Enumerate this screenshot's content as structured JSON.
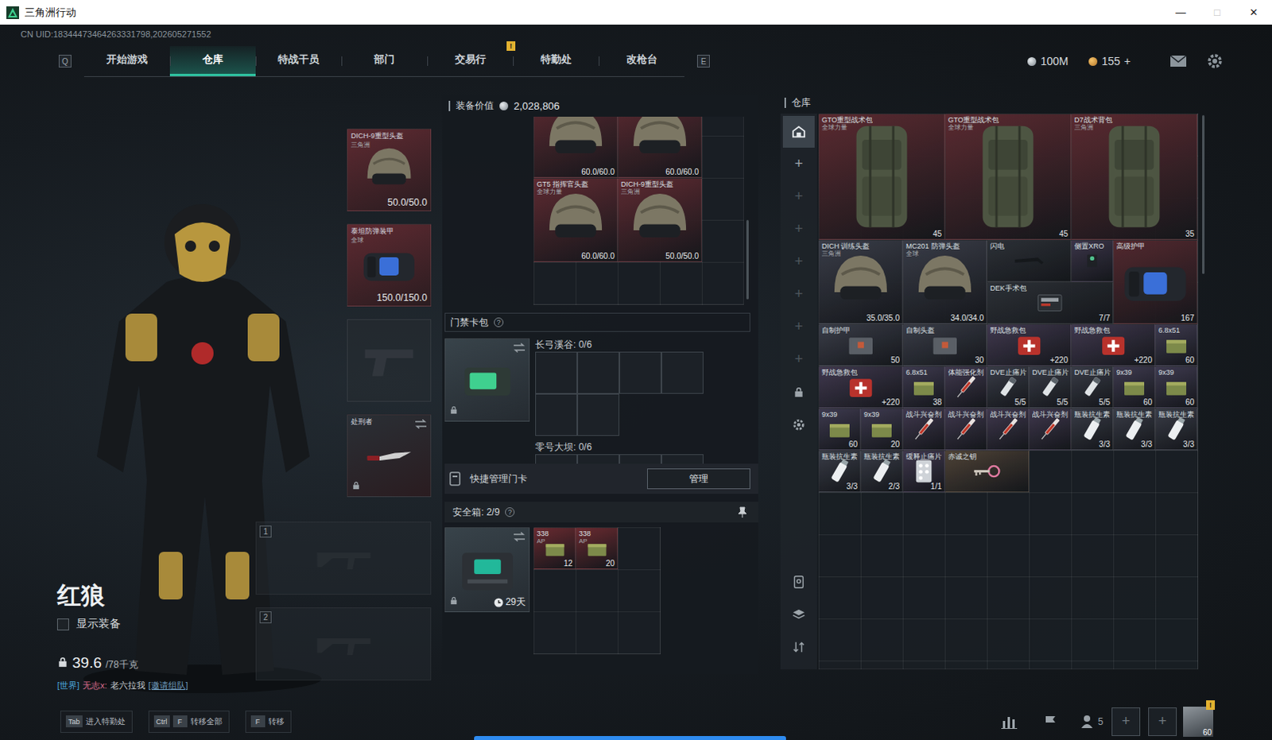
{
  "window": {
    "title": "三角洲行动",
    "controls": [
      "—",
      "□",
      "✕"
    ]
  },
  "uid": "CN UID:18344473464263331798,202605271552",
  "nav": {
    "left_key": "Q",
    "right_key": "E",
    "tabs": [
      {
        "label": "开始游戏",
        "selected": false,
        "badge": ""
      },
      {
        "label": "仓库",
        "selected": true,
        "badge": ""
      },
      {
        "label": "特战干员",
        "selected": false,
        "badge": ""
      },
      {
        "label": "部门",
        "selected": false,
        "badge": ""
      },
      {
        "label": "交易行",
        "selected": false,
        "badge": ""
      },
      {
        "label": "特勤处",
        "selected": false,
        "badge": "!"
      },
      {
        "label": "改枪台",
        "selected": false,
        "badge": ""
      }
    ],
    "currencies": [
      {
        "kind": "silver",
        "value": "100M",
        "action": ""
      },
      {
        "kind": "gold",
        "value": "155",
        "action": "+"
      }
    ]
  },
  "character": {
    "name": "红狼",
    "show_equipment": {
      "label": "显示装备",
      "checked": false
    },
    "weight": {
      "value": "39.6",
      "max": "/78千克"
    },
    "chat": {
      "channel": "[世界]",
      "sender": "无志x:",
      "message": "老六拉我",
      "action": "[邀请组队]"
    }
  },
  "equipment": [
    {
      "kind": "helmet",
      "filled": true,
      "name": "DICH-9重型头盔",
      "sub": "三角洲",
      "durability": "50.0/50.0",
      "locked": false,
      "color": "#5e2a31"
    },
    {
      "kind": "armor",
      "filled": true,
      "name": "泰坦防弹装甲",
      "sub": "全球",
      "durability": "150.0/150.0",
      "locked": false,
      "color": "#5e2a31"
    },
    {
      "kind": "pistol",
      "filled": false,
      "name": "",
      "sub": "",
      "durability": "",
      "locked": false,
      "color": "#262b31"
    },
    {
      "kind": "melee",
      "filled": true,
      "name": "处刑者",
      "sub": "",
      "durability": "",
      "locked": true,
      "color": "#2a2f35"
    }
  ],
  "weapons": [
    {
      "index": "1",
      "filled": false
    },
    {
      "index": "2",
      "filled": false
    }
  ],
  "loadout": {
    "title": "装备价值",
    "value": "2,028,806",
    "items": [
      {
        "kind": "helmet",
        "name": "",
        "sub": "",
        "durability": "60.0/60.0",
        "color": "#5e2a31"
      },
      {
        "kind": "helmet",
        "name": "",
        "sub": "",
        "durability": "60.0/60.0",
        "color": "#5e2a31"
      },
      {
        "kind": "helmet",
        "name": "GT5 指挥官头盔",
        "sub": "全球力量",
        "durability": "60.0/60.0",
        "color": "#5e2a31"
      },
      {
        "kind": "helmet",
        "name": "DICH-9重型头盔",
        "sub": "三角洲",
        "durability": "50.0/50.0",
        "color": "#5e2a31"
      }
    ]
  },
  "keycards": {
    "title": "门禁卡包",
    "help": "?",
    "locked": true,
    "zones": [
      {
        "label": "长弓溪谷: 0/6",
        "slots": 6
      },
      {
        "label": "零号大坝: 0/6",
        "slots": 6
      }
    ],
    "manage_label": "快捷管理门卡",
    "manage_button": "管理"
  },
  "safe": {
    "title": "安全箱: 2/9",
    "help": "?",
    "expiry": "29天",
    "locked": true,
    "slots": 9,
    "items": [
      {
        "line1": "338",
        "line2": "AP",
        "count": "12",
        "color": "#6a2a30"
      },
      {
        "line1": "338",
        "line2": "AP",
        "count": "20",
        "color": "#6a2a30"
      }
    ]
  },
  "warehouse": {
    "title": "仓库",
    "sidebar": [
      {
        "kind": "warehouse",
        "label": "",
        "selected": true,
        "disabled": false
      },
      {
        "kind": "add",
        "label": "+",
        "selected": false,
        "disabled": false
      },
      {
        "kind": "add",
        "label": "+",
        "selected": false,
        "disabled": true
      },
      {
        "kind": "add",
        "label": "+",
        "selected": false,
        "disabled": true
      },
      {
        "kind": "add",
        "label": "+",
        "selected": false,
        "disabled": true
      },
      {
        "kind": "add",
        "label": "+",
        "selected": false,
        "disabled": true
      },
      {
        "kind": "add",
        "label": "+",
        "selected": false,
        "disabled": true
      },
      {
        "kind": "add",
        "label": "+",
        "selected": false,
        "disabled": true
      },
      {
        "kind": "lock",
        "label": "",
        "selected": false,
        "disabled": false
      },
      {
        "kind": "settings",
        "label": "",
        "selected": false,
        "disabled": false
      },
      {
        "kind": "vault",
        "label": "",
        "selected": false,
        "disabled": false
      },
      {
        "kind": "layers",
        "label": "",
        "selected": false,
        "disabled": false
      },
      {
        "kind": "sort",
        "label": "",
        "selected": false,
        "disabled": false
      }
    ],
    "items": [
      {
        "kind": "backpack",
        "name": "GTO重型战术包",
        "sub": "全球力量",
        "count": "45",
        "color": "#5b2a30"
      },
      {
        "kind": "backpack",
        "name": "GTO重型战术包",
        "sub": "全球力量",
        "count": "45",
        "color": "#5b2a30"
      },
      {
        "kind": "backpack",
        "name": "D7战术背包",
        "sub": "三角洲",
        "count": "35",
        "color": "#5b2a30"
      },
      {
        "kind": "helmet",
        "name": "DICH 训练头盔",
        "sub": "三角洲",
        "count": "35.0/35.0",
        "color": "#393c47"
      },
      {
        "kind": "helmet",
        "name": "MC201 防弹头盔",
        "sub": "全球",
        "count": "34.0/34.0",
        "color": "#393c47"
      },
      {
        "kind": "tool-wide",
        "name": "闪电",
        "sub": "",
        "count": "",
        "color": "#2c3036"
      },
      {
        "kind": "tool",
        "name": "侧置XRO",
        "sub": "",
        "count": "",
        "color": "#3a3448"
      },
      {
        "kind": "armor",
        "name": "高级护甲",
        "sub": "",
        "count": "167",
        "color": "#53282e"
      },
      {
        "kind": "surgical",
        "name": "DEK手术包",
        "sub": "",
        "count": "7/7",
        "color": "#2c3036"
      },
      {
        "kind": "case",
        "name": "自制护甲",
        "sub": "",
        "count": "50",
        "color": "#393c47"
      },
      {
        "kind": "case",
        "name": "自制头盔",
        "sub": "",
        "count": "30",
        "color": "#393c47"
      },
      {
        "kind": "medkit",
        "name": "野战急救包",
        "sub": "",
        "count": "+220",
        "color": "#40384e"
      },
      {
        "kind": "medkit",
        "name": "野战急救包",
        "sub": "",
        "count": "+220",
        "color": "#40384e"
      },
      {
        "kind": "ammo",
        "name": "6.8x51",
        "sub": "",
        "count": "60",
        "color": "#3e3a4f"
      },
      {
        "kind": "medkit",
        "name": "野战急救包",
        "sub": "",
        "count": "+220",
        "color": "#40384e"
      },
      {
        "kind": "ammo",
        "name": "6.8x51",
        "sub": "",
        "count": "38",
        "color": "#3e3a4f"
      },
      {
        "kind": "syringe",
        "name": "体能强化剂",
        "sub": "",
        "count": "",
        "color": "#40384e"
      },
      {
        "kind": "pills",
        "name": "DVE止痛片",
        "sub": "",
        "count": "5/5",
        "color": "#393c47"
      },
      {
        "kind": "pills",
        "name": "DVE止痛片",
        "sub": "",
        "count": "5/5",
        "color": "#393c47"
      },
      {
        "kind": "pills",
        "name": "DVE止痛片",
        "sub": "",
        "count": "5/5",
        "color": "#393c47"
      },
      {
        "kind": "ammo",
        "name": "9x39",
        "sub": "",
        "count": "60",
        "color": "#3e3a4f"
      },
      {
        "kind": "ammo",
        "name": "9x39",
        "sub": "",
        "count": "60",
        "color": "#3e3a4f"
      },
      {
        "kind": "ammo",
        "name": "9x39",
        "sub": "",
        "count": "60",
        "color": "#3e3a4f"
      },
      {
        "kind": "ammo",
        "name": "9x39",
        "sub": "",
        "count": "20",
        "color": "#3e3a4f"
      },
      {
        "kind": "syringe",
        "name": "战斗兴奋剂",
        "sub": "",
        "count": "",
        "color": "#40384e"
      },
      {
        "kind": "syringe",
        "name": "战斗兴奋剂",
        "sub": "",
        "count": "",
        "color": "#40384e"
      },
      {
        "kind": "syringe",
        "name": "战斗兴奋剂",
        "sub": "",
        "count": "",
        "color": "#40384e"
      },
      {
        "kind": "syringe",
        "name": "战斗兴奋剂",
        "sub": "",
        "count": "",
        "color": "#40384e"
      },
      {
        "kind": "bottle",
        "name": "瓶装抗生素",
        "sub": "",
        "count": "3/3",
        "color": "#393c47"
      },
      {
        "kind": "bottle",
        "name": "瓶装抗生素",
        "sub": "",
        "count": "3/3",
        "color": "#393c47"
      },
      {
        "kind": "bottle",
        "name": "瓶装抗生素",
        "sub": "",
        "count": "3/3",
        "color": "#393c47"
      },
      {
        "kind": "bottle",
        "name": "瓶装抗生素",
        "sub": "",
        "count": "3/3",
        "color": "#393c47"
      },
      {
        "kind": "bottle",
        "name": "瓶装抗生素",
        "sub": "",
        "count": "2/3",
        "color": "#393c47"
      },
      {
        "kind": "blister",
        "name": "缓释止痛片",
        "sub": "",
        "count": "1/1",
        "color": "#40384e"
      },
      {
        "kind": "key",
        "name": "赤诚之钥",
        "sub": "",
        "count": "",
        "color": "#4e4236"
      }
    ]
  },
  "hints": [
    {
      "keys": [
        "Tab"
      ],
      "label": "进入特勤处"
    },
    {
      "keys": [
        "Ctrl",
        "F"
      ],
      "label": "转移全部"
    },
    {
      "keys": [
        "F"
      ],
      "label": "转移"
    }
  ],
  "social": {
    "friends": "5",
    "slots": [
      "+",
      "+"
    ],
    "level": "60",
    "badge": "!"
  }
}
